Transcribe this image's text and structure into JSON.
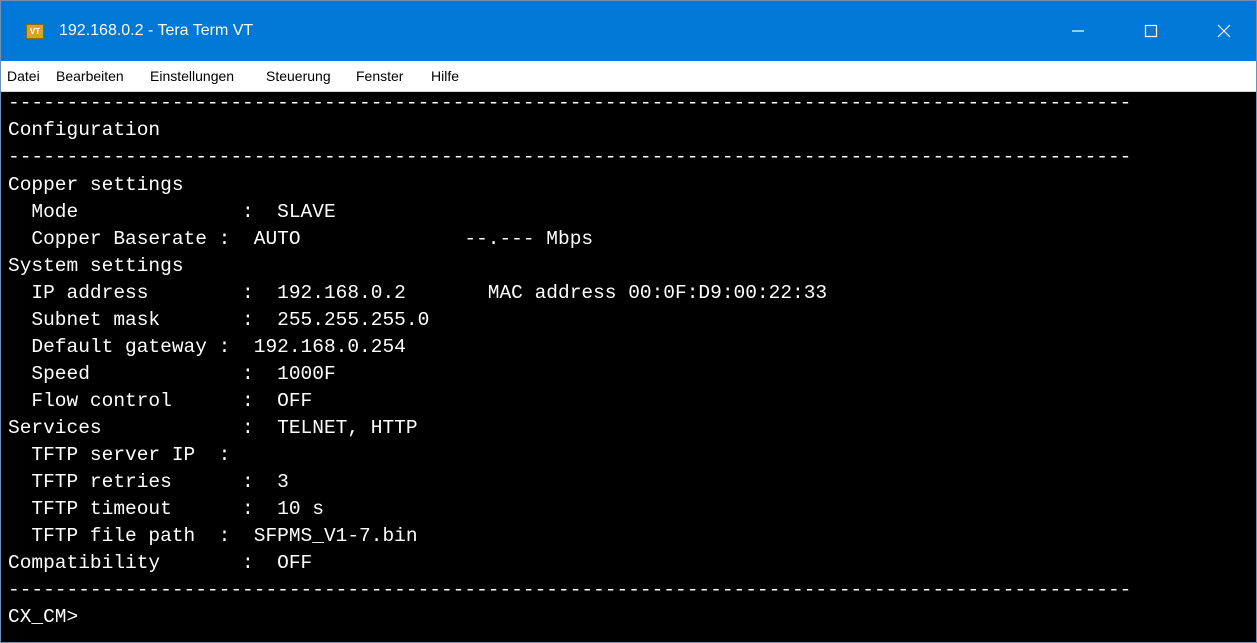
{
  "window": {
    "title": "192.168.0.2 - Tera Term VT",
    "icon": "teraterm-icon",
    "icon_text": "VT",
    "controls": {
      "minimize": "minimize-icon",
      "maximize": "maximize-icon",
      "close": "close-icon"
    }
  },
  "menu": {
    "items": [
      "Datei",
      "Bearbeiten",
      "Einstellungen",
      "Steuerung",
      "Fenster",
      "Hilfe"
    ]
  },
  "terminal": {
    "lines": [
      "------------------------------------------------------------------------------------------------",
      "Configuration",
      "------------------------------------------------------------------------------------------------",
      "Copper settings",
      "  Mode              :  SLAVE",
      "  Copper Baserate :  AUTO              --.--- Mbps",
      "System settings",
      "  IP address        :  192.168.0.2       MAC address 00:0F:D9:00:22:33",
      "  Subnet mask       :  255.255.255.0",
      "  Default gateway :  192.168.0.254",
      "  Speed             :  1000F",
      "  Flow control      :  OFF",
      "Services            :  TELNET, HTTP",
      "  TFTP server IP  :",
      "  TFTP retries      :  3",
      "  TFTP timeout      :  10 s",
      "  TFTP file path  :  SFPMS_V1-7.bin",
      "Compatibility       :  OFF",
      "------------------------------------------------------------------------------------------------",
      "CX_CM>"
    ]
  },
  "colors": {
    "titlebar": "#0078d7",
    "terminal_bg": "#000000",
    "terminal_fg": "#ffffff"
  }
}
